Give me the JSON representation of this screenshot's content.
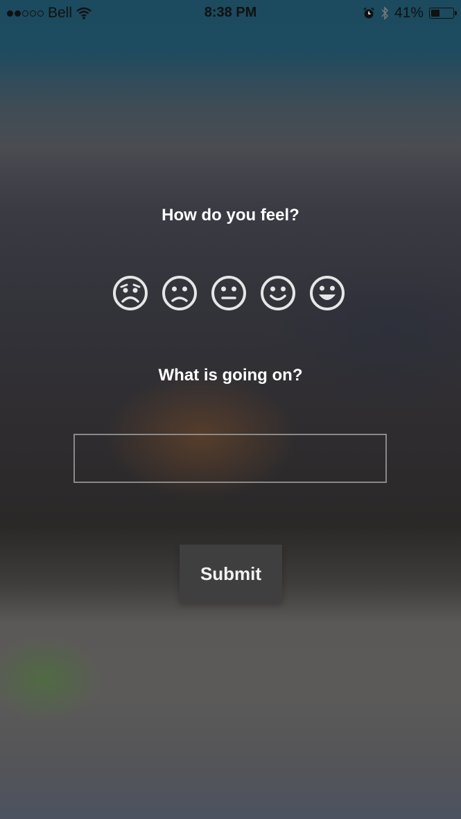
{
  "status_bar": {
    "carrier": "Bell",
    "time": "8:38 PM",
    "battery_percent": "41%",
    "battery_level": 0.41,
    "signal_bars_filled": 2,
    "signal_bars_total": 5,
    "icons": [
      "wifi-icon",
      "alarm-icon",
      "bluetooth-icon",
      "battery-icon"
    ]
  },
  "form": {
    "feel_question": "How do you feel?",
    "moods": [
      "very-sad",
      "sad",
      "neutral",
      "happy",
      "very-happy"
    ],
    "whats_going_on_question": "What is going on?",
    "description_value": "",
    "description_placeholder": "",
    "submit_label": "Submit"
  },
  "colors": {
    "icon_stroke": "#e6e6e6",
    "submit_bg": "#3f3f40",
    "field_border": "#8a8a8a"
  }
}
